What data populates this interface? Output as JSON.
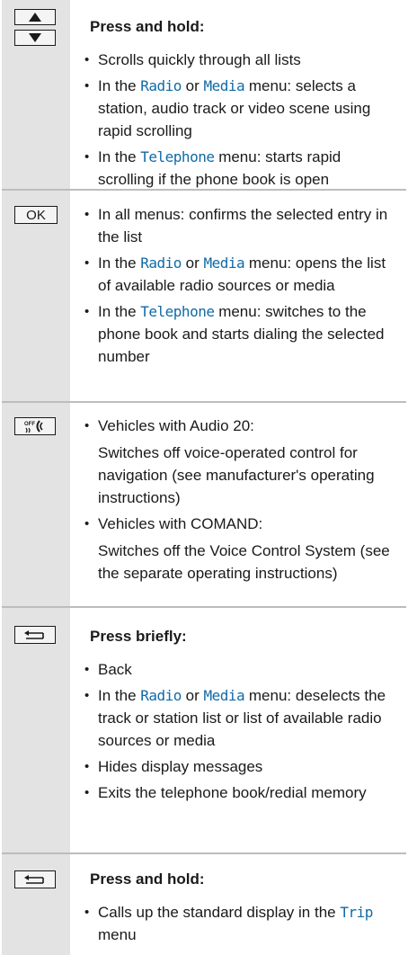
{
  "rows": [
    {
      "keys": [
        "up-arrow-key",
        "down-arrow-key"
      ],
      "heading": "Press and hold:",
      "items": [
        {
          "text": "Scrolls quickly through all lists"
        },
        {
          "pre": "In the ",
          "m1": "Radio",
          "mid": " or ",
          "m2": "Media",
          "post": " menu: selects a station, audio track or video scene using rapid scrolling"
        },
        {
          "pre": "In the ",
          "m1": "Telephone",
          "post": " menu: starts rapid scrolling if the phone book is open"
        }
      ]
    },
    {
      "keys": [
        "ok-key"
      ],
      "key_label": "OK",
      "items": [
        {
          "text": "In all menus: confirms the selected entry in the list"
        },
        {
          "pre": "In the ",
          "m1": "Radio",
          "mid": " or ",
          "m2": "Media",
          "post": " menu: opens the list of available radio sources or media"
        },
        {
          "pre": "In the ",
          "m1": "Telephone",
          "post": " menu: switches to the phone book and starts dialing the selected number"
        }
      ]
    },
    {
      "keys": [
        "voice-off-key"
      ],
      "key_label": "OFF",
      "items": [
        {
          "text": "Vehicles with Audio 20:",
          "sub": "Switches off voice-operated control for navigation (see manufacturer's operating instructions)"
        },
        {
          "text": "Vehicles with COMAND:",
          "sub": "Switches off the Voice Control System (see the separate operating instructions)"
        }
      ]
    },
    {
      "keys": [
        "back-key"
      ],
      "heading": "Press briefly:",
      "items": [
        {
          "text": "Back"
        },
        {
          "pre": "In the ",
          "m1": "Radio",
          "mid": " or ",
          "m2": "Media",
          "post": " menu: deselects the track or station list or list of available radio sources or media"
        },
        {
          "text": "Hides display messages"
        },
        {
          "text": "Exits the telephone book/redial memory"
        }
      ]
    },
    {
      "keys": [
        "back-key"
      ],
      "heading": "Press and hold:",
      "items": [
        {
          "text": "Calls up the standard display in the ",
          "m_after": "Trip",
          "post": " menu"
        }
      ]
    }
  ]
}
